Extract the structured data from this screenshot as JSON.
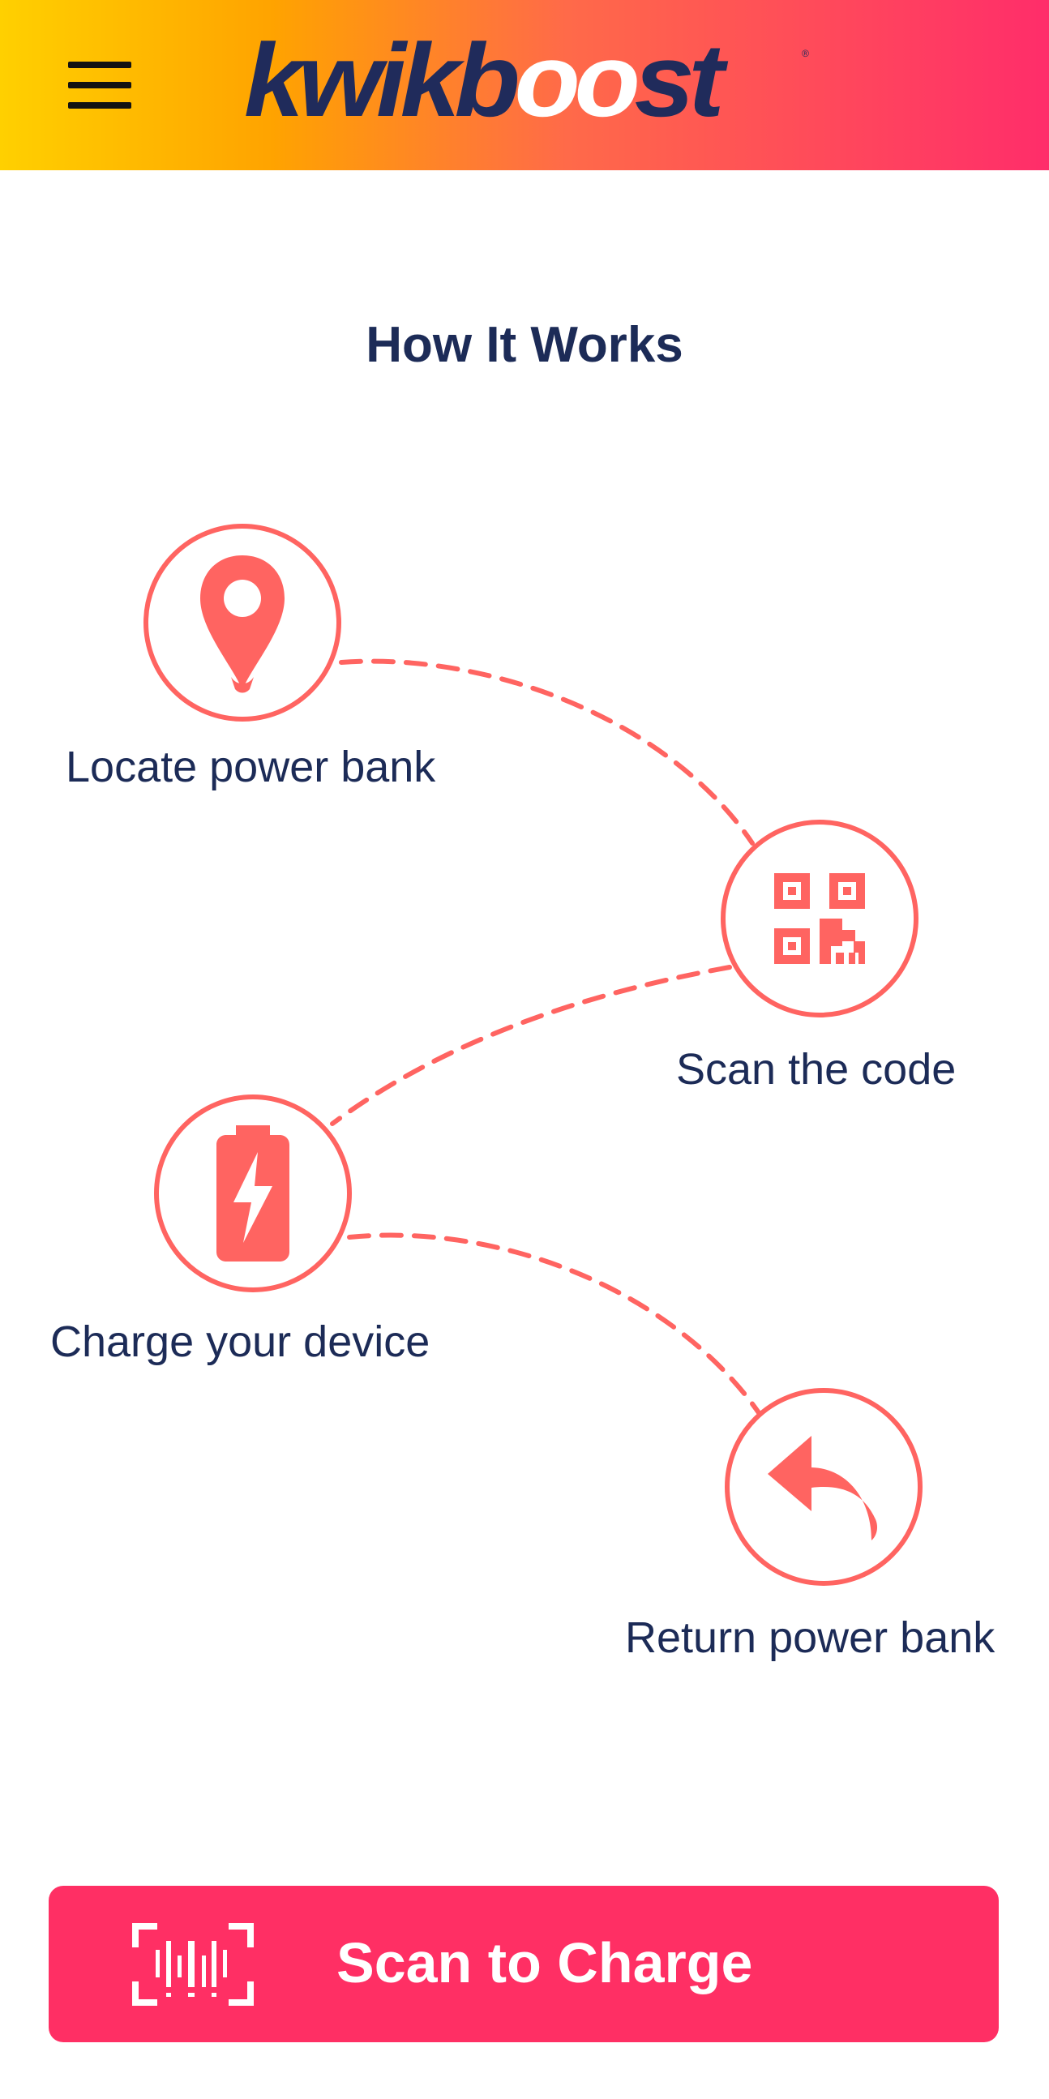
{
  "app": {
    "brand": {
      "primary_text": "kwikb",
      "highlight_text": "oo",
      "secondary_text": "st",
      "mark": "®",
      "color": "#202b5b",
      "highlight_color": "#ffffff"
    }
  },
  "header": {
    "menu_icon": "hamburger-menu-icon",
    "gradient_colors": [
      "#ffd000",
      "#ffa300",
      "#ff6a49",
      "#ff2d6a"
    ]
  },
  "main": {
    "title": "How It Works",
    "accent_color": "#ff6461",
    "steps": [
      {
        "label": "Locate power bank",
        "icon": "location-pin-icon"
      },
      {
        "label": "Scan the code",
        "icon": "qr-code-icon"
      },
      {
        "label": "Charge your device",
        "icon": "battery-charging-icon"
      },
      {
        "label": "Return power bank",
        "icon": "return-arrow-icon"
      }
    ]
  },
  "footer": {
    "scan_button": {
      "label": "Scan to Charge",
      "icon": "barcode-scan-icon",
      "color": "#ff2f64",
      "text_color": "#ffffff"
    }
  }
}
